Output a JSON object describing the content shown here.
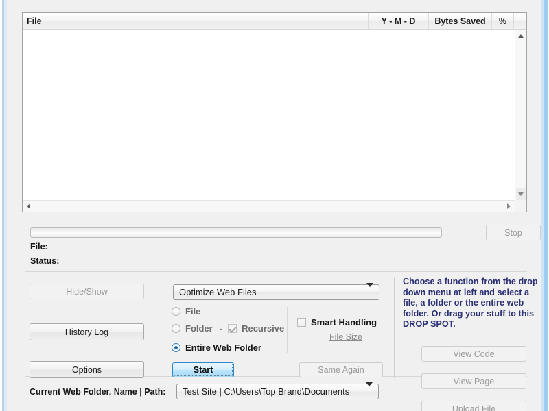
{
  "listview": {
    "columns": [
      {
        "key": "file",
        "label": "File"
      },
      {
        "key": "ymd",
        "label": "Y - M - D"
      },
      {
        "key": "bytes",
        "label": "Bytes Saved"
      },
      {
        "key": "pct",
        "label": "%"
      }
    ],
    "rows": [],
    "vertical_scrollbar": {
      "up_icon": "triangle-up-icon",
      "down_icon": "triangle-down-icon"
    },
    "horizontal_scrollbar": {
      "left_icon": "triangle-left-icon",
      "right_icon": "triangle-right-icon"
    }
  },
  "progress": {
    "value": 0,
    "stop_label": "Stop",
    "stop_disabled": true,
    "file_label": "File:",
    "file_value": "",
    "status_label": "Status:",
    "status_value": ""
  },
  "left_panel": {
    "hide_show_label": "Hide/Show",
    "hide_show_disabled": true,
    "history_log_label": "History Log",
    "options_label": "Options"
  },
  "center_panel": {
    "function_combo": {
      "selected": "Optimize Web Files",
      "arrow_icon": "chevron-down-icon"
    },
    "scope_options": [
      {
        "label": "File",
        "checked": false,
        "dim": true
      },
      {
        "label": "Folder",
        "checked": false,
        "dim": true
      },
      {
        "label": "Entire Web Folder",
        "checked": true,
        "dim": false
      }
    ],
    "folder_dash": "-",
    "recursive_label": "Recursive",
    "recursive_checked": true,
    "recursive_disabled": true,
    "smart_handling_label": "Smart Handling",
    "smart_handling_checked": false,
    "file_size_link": "File Size",
    "start_label": "Start",
    "same_again_label": "Same Again",
    "same_again_disabled": true
  },
  "right_panel": {
    "drop_spot_text": "Choose a function from the drop down menu at left and select a file, a folder or the entire web folder. Or drag your stuff to this DROP SPOT.",
    "view_code_label": "View Code",
    "view_code_disabled": true,
    "view_page_label": "View Page",
    "view_page_disabled": true,
    "upload_file_label": "Upload File",
    "upload_file_disabled": true
  },
  "footer": {
    "path_label": "Current Web Folder, Name | Path:",
    "path_combo": {
      "selected": "Test Site  |  C:\\Users\\Top Brand\\Documents",
      "arrow_icon": "chevron-down-icon"
    }
  },
  "colors": {
    "accent_blue": "#3c7fb1",
    "drop_text": "#2b2f73",
    "window_border": "#9dcdf0",
    "panel_bg": "#f0f0f0"
  }
}
